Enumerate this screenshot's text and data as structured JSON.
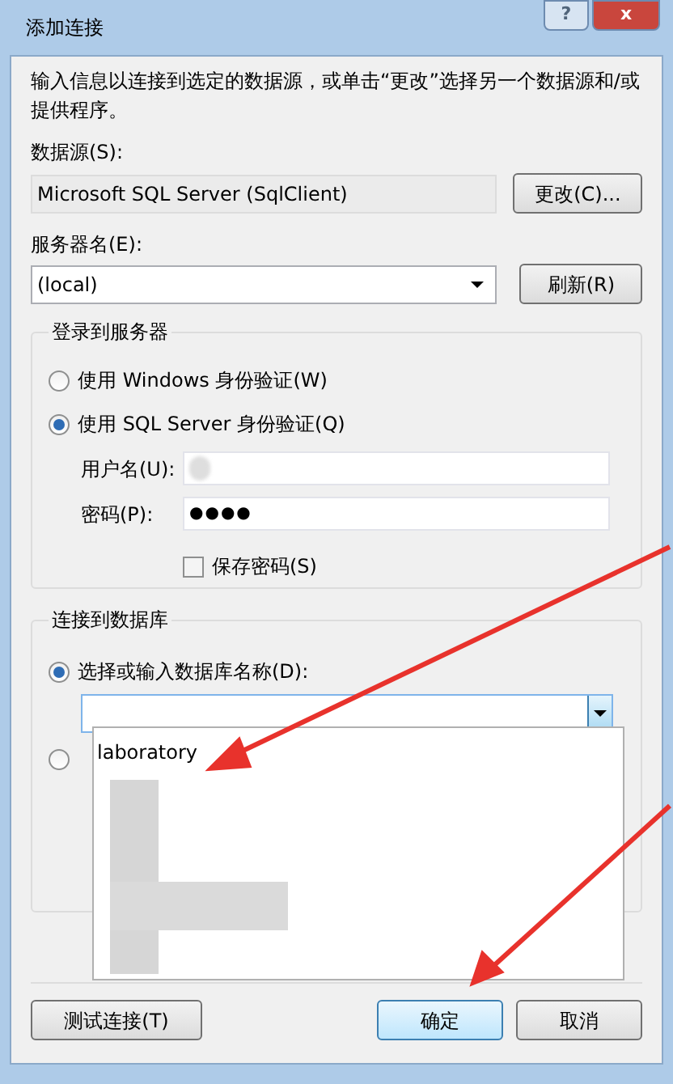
{
  "window": {
    "title": "添加连接",
    "title_buttons": [
      "?",
      "x"
    ]
  },
  "description": "输入信息以连接到选定的数据源，或单击“更改”选择另一个数据源和/或提供程序。",
  "data_source": {
    "label": "数据源(S):",
    "value": "Microsoft SQL Server (SqlClient)",
    "button": "更改(C)..."
  },
  "server": {
    "label": "服务器名(E):",
    "value": "(local)",
    "button": "刷新(R)"
  },
  "login_group": {
    "title": "登录到服务器",
    "options": [
      {
        "label": "使用 Windows 身份验证(W)",
        "selected": false
      },
      {
        "label": "使用 SQL Server 身份验证(Q)",
        "selected": true
      }
    ],
    "username": {
      "label": "用户名(U):"
    },
    "password": {
      "label": "密码(P):",
      "value": "●●●●"
    },
    "save_password": {
      "label": "保存密码(S)",
      "checked": false
    }
  },
  "database_group": {
    "title": "连接到数据库",
    "options": [
      {
        "label": "选择或输入数据库名称(D):",
        "selected": true
      },
      {
        "selected": false
      }
    ],
    "dropdown": {
      "open": true,
      "items": [
        "laboratory"
      ]
    }
  },
  "buttons": [
    {
      "label": "测试连接(T)",
      "default": false
    },
    {
      "label": "确定",
      "default": true
    },
    {
      "label": "取消",
      "default": false
    }
  ]
}
